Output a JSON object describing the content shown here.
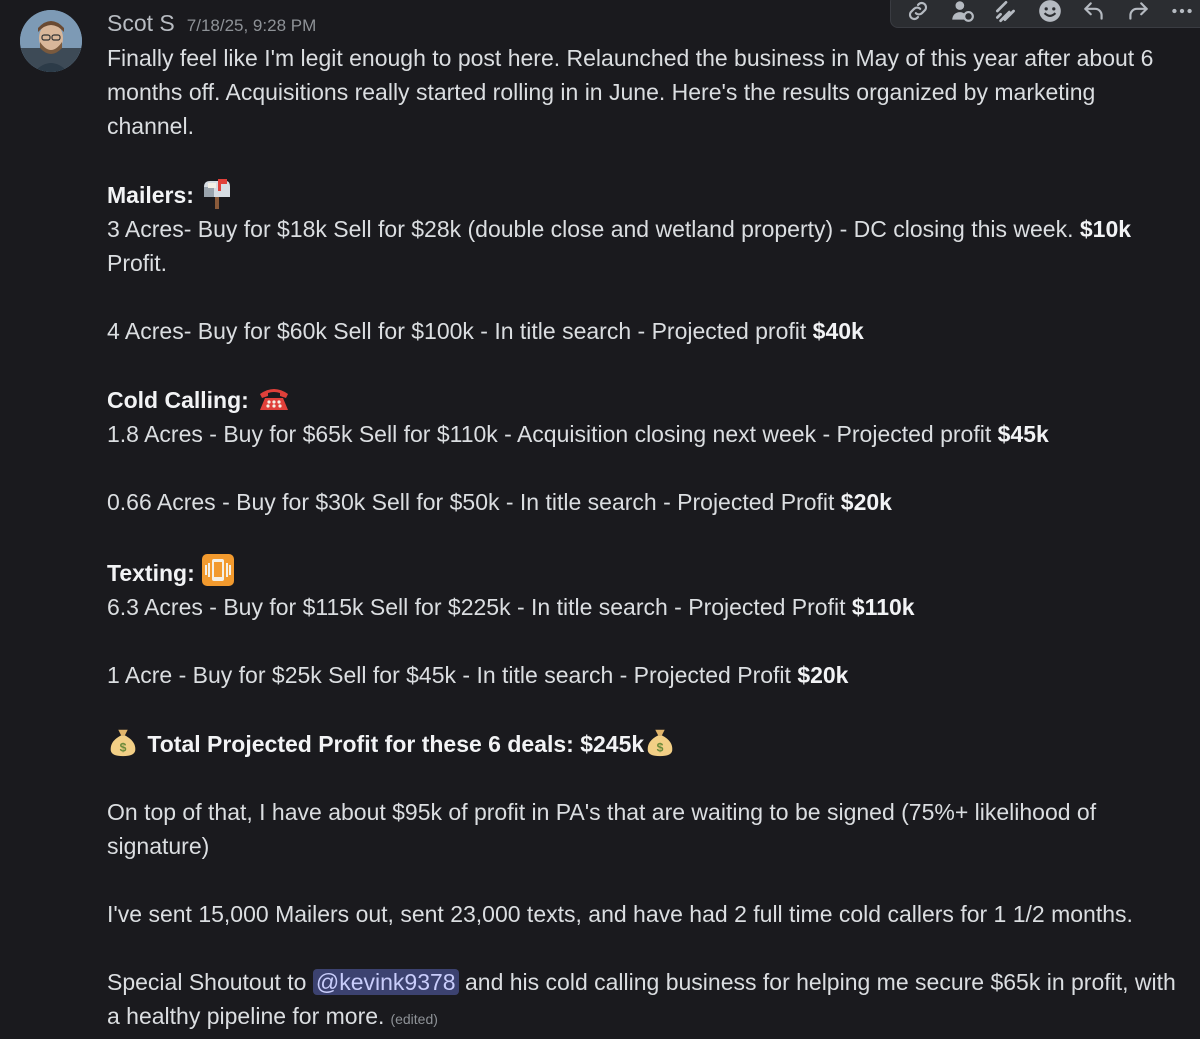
{
  "message": {
    "username": "Scot S",
    "timestamp": "7/18/25, 9:28 PM",
    "intro": "Finally feel like I'm legit enough to post here. Relaunched the business in May of this year after about 6 months off. Acquisitions really started rolling in in June. Here's the results organized by marketing channel.",
    "mailers": {
      "heading": "Mailers:",
      "emoji": "mailbox-icon",
      "deal1_text": "3 Acres- Buy for $18k Sell for $28k (double close and wetland property) - DC closing this week. ",
      "deal1_bold": "$10k",
      "deal1_after": " Profit.",
      "deal2_text": "4 Acres- Buy for $60k Sell for $100k - In title search - Projected profit ",
      "deal2_bold": "$40k"
    },
    "cold_calling": {
      "heading": "Cold Calling:",
      "emoji": "telephone-icon",
      "deal1_text": "1.8 Acres - Buy for $65k Sell for $110k - Acquisition closing next week - Projected profit ",
      "deal1_bold": "$45k",
      "deal2_text": "0.66 Acres - Buy for $30k Sell for $50k - In title search - Projected Profit ",
      "deal2_bold": "$20k"
    },
    "texting": {
      "heading": "Texting:",
      "emoji": "vibrating-phone-icon",
      "deal1_text": "6.3 Acres - Buy for $115k Sell for $225k - In title search - Projected Profit ",
      "deal1_bold": "$110k",
      "deal2_text": "1 Acre - Buy for $25k Sell for $45k - In title search - Projected Profit ",
      "deal2_bold": "$20k"
    },
    "total": "Total Projected Profit for these 6 deals: $245k",
    "total_emoji": "money-bag-icon",
    "pa_text": "On top of that, I have about $95k of profit in PA's that are waiting to be signed (75%+ likelihood of signature)",
    "volume_text": "I've sent 15,000 Mailers out, sent 23,000 texts, and have had 2 full time cold callers for 1 1/2 months.",
    "shoutout_before": "Special Shoutout to ",
    "mention": "@kevink9378",
    "shoutout_after": " and his cold calling business for helping me secure $65k in profit, with a healthy pipeline for more.",
    "edited": "(edited)"
  },
  "toolbar": [
    "copy-link-icon",
    "reply-thread-icon",
    "signal-icon",
    "add-reaction-icon",
    "reply-icon",
    "forward-icon",
    "more-icon"
  ],
  "colors": {
    "background": "#1a1a1e",
    "text": "#dbdee1",
    "mention_bg": "#3c4270",
    "mention_text": "#c9cdfb"
  }
}
